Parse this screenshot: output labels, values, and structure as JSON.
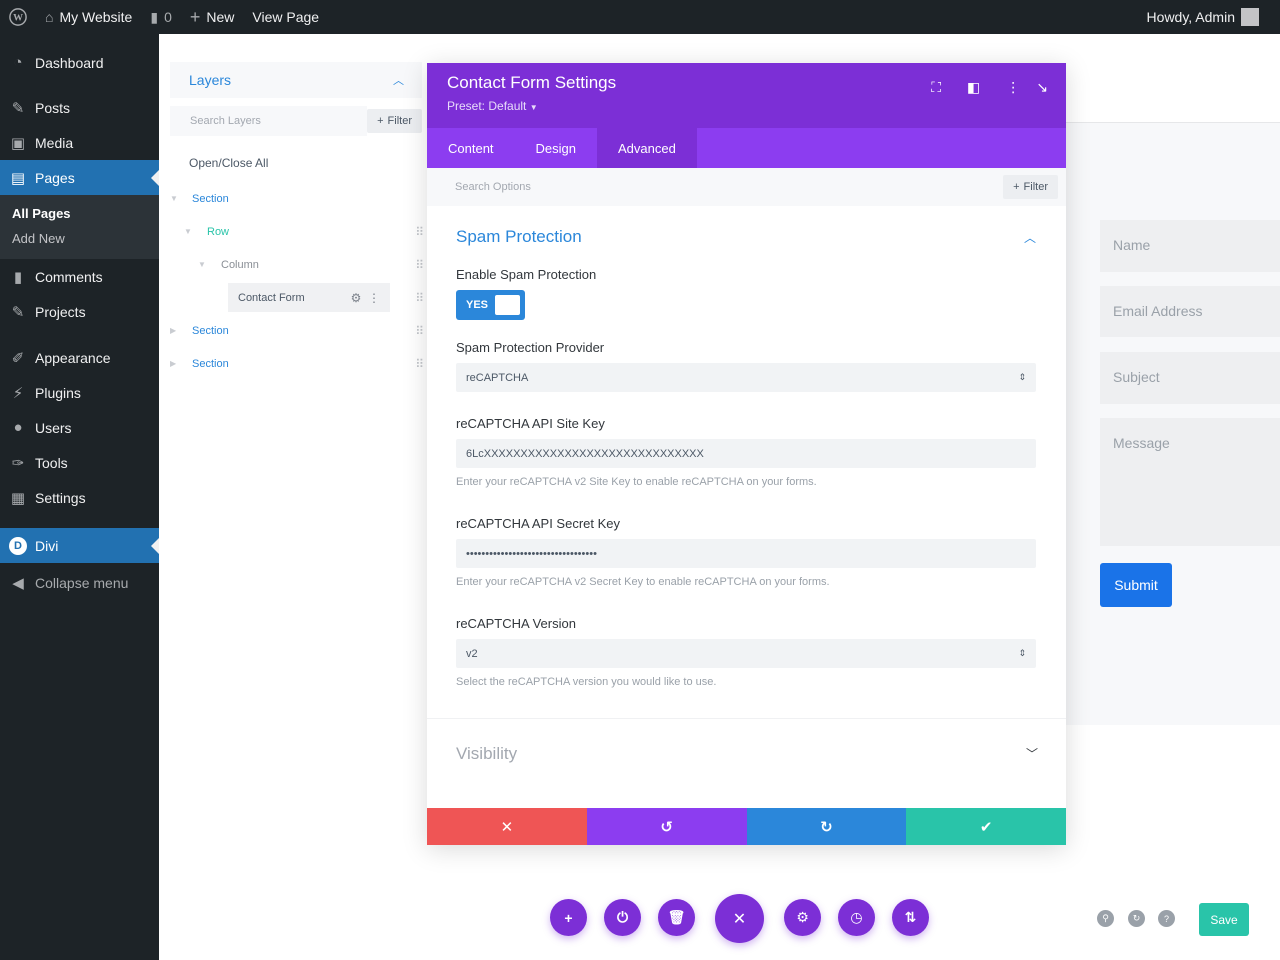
{
  "adminbar": {
    "site_name": "My Website",
    "comments_count": "0",
    "new_label": "New",
    "view_page_label": "View Page",
    "howdy": "Howdy, Admin"
  },
  "sidebar": {
    "items": [
      {
        "label": "Dashboard",
        "icon": "dashboard-icon"
      },
      {
        "label": "Posts",
        "icon": "pin-icon"
      },
      {
        "label": "Media",
        "icon": "media-icon"
      },
      {
        "label": "Pages",
        "icon": "pages-icon"
      },
      {
        "label": "Comments",
        "icon": "comment-icon"
      },
      {
        "label": "Projects",
        "icon": "pin-icon"
      },
      {
        "label": "Appearance",
        "icon": "brush-icon"
      },
      {
        "label": "Plugins",
        "icon": "plug-icon"
      },
      {
        "label": "Users",
        "icon": "user-icon"
      },
      {
        "label": "Tools",
        "icon": "wrench-icon"
      },
      {
        "label": "Settings",
        "icon": "settings-icon"
      },
      {
        "label": "Divi",
        "icon": "divi-icon"
      },
      {
        "label": "Collapse menu",
        "icon": "collapse-icon"
      }
    ],
    "submenu": [
      "All Pages",
      "Add New"
    ]
  },
  "layers": {
    "title": "Layers",
    "search_placeholder": "Search Layers",
    "filter_label": "Filter",
    "open_close_all": "Open/Close All",
    "tree": [
      {
        "label": "Section",
        "type": "section"
      },
      {
        "label": "Row",
        "type": "row"
      },
      {
        "label": "Column",
        "type": "column"
      },
      {
        "label": "Contact Form",
        "type": "module"
      },
      {
        "label": "Section",
        "type": "section"
      },
      {
        "label": "Section",
        "type": "section"
      }
    ]
  },
  "modal": {
    "title": "Contact Form Settings",
    "preset": "Preset: Default",
    "tabs": [
      "Content",
      "Design",
      "Advanced"
    ],
    "active_tab": "Advanced",
    "search_placeholder": "Search Options",
    "filter_label": "Filter",
    "group_title": "Spam Protection",
    "enable_label": "Enable Spam Protection",
    "toggle_value": "YES",
    "provider_label": "Spam Protection Provider",
    "provider_value": "reCAPTCHA",
    "site_key_label": "reCAPTCHA API Site Key",
    "site_key_value": "6LcXXXXXXXXXXXXXXXXXXXXXXXXXXXXXX",
    "site_key_help": "Enter your reCAPTCHA v2 Site Key to enable reCAPTCHA on your forms.",
    "secret_key_label": "reCAPTCHA API Secret Key",
    "secret_key_value": "••••••••••••••••••••••••••••••••••",
    "secret_key_help": "Enter your reCAPTCHA v2 Secret Key to enable reCAPTCHA on your forms.",
    "version_label": "reCAPTCHA Version",
    "version_value": "v2",
    "version_help": "Select the reCAPTCHA version you would like to use.",
    "visibility_label": "Visibility"
  },
  "form_preview": {
    "name_placeholder": "Name",
    "email_placeholder": "Email Address",
    "subject_placeholder": "Subject",
    "message_placeholder": "Message",
    "submit_label": "Submit"
  },
  "bottom_bar": {
    "save_label": "Save"
  },
  "colors": {
    "admin_dark": "#1d2327",
    "wp_blue": "#2271b1",
    "divi_purple": "#7c2fd6",
    "divi_blue": "#2b87da",
    "cancel_red": "#ef5555",
    "undo_purple": "#8c3df0",
    "redo_blue": "#2b87da",
    "save_green": "#29c4a9"
  }
}
